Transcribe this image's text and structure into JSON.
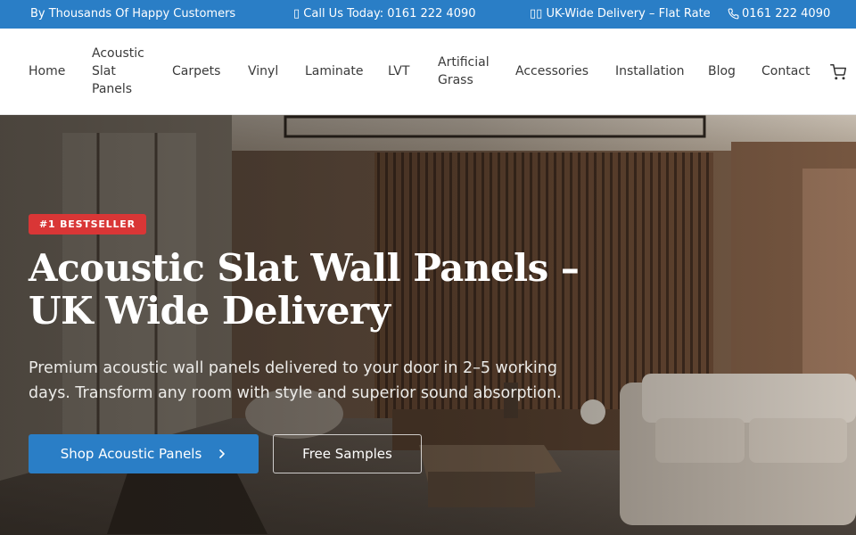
{
  "topbar": {
    "customers": "By Thousands Of Happy Customers",
    "call": "▯ Call Us Today: 0161 222 4090",
    "delivery": "▯▯ UK-Wide Delivery – Flat Rate",
    "phone": "0161 222 4090",
    "phone_icon": "phone-icon",
    "bg_color": "#2a7ec6"
  },
  "nav": {
    "items": [
      {
        "label": "Home"
      },
      {
        "label": "Acoustic Slat Panels"
      },
      {
        "label": "Carpets"
      },
      {
        "label": "Vinyl"
      },
      {
        "label": "Laminate"
      },
      {
        "label": "LVT"
      },
      {
        "label": "Artificial Grass"
      },
      {
        "label": "Accessories"
      },
      {
        "label": "Installation"
      },
      {
        "label": "Blog"
      },
      {
        "label": "Contact"
      }
    ],
    "cart_icon": "cart-icon"
  },
  "hero": {
    "badge": "#1 BESTSELLER",
    "badge_color": "#d93636",
    "title": "Acoustic Slat Wall Panels – UK Wide Delivery",
    "subtitle": "Premium acoustic wall panels delivered to your door in 2–5 working days. Transform any room with style and superior sound absorption.",
    "primary_button": "Shop Acoustic Panels",
    "primary_button_icon": "chevron-right-icon",
    "secondary_button": "Free Samples",
    "accent_color": "#2a7ec6"
  }
}
